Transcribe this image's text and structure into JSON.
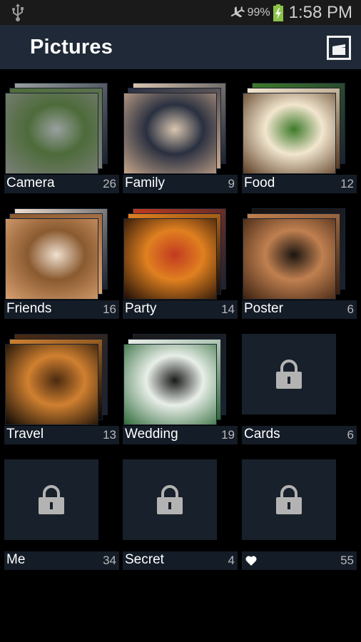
{
  "status_bar": {
    "left_icons": [
      "usb-icon"
    ],
    "right_icons": [
      "airplane-mode-icon",
      "battery-charging-icon"
    ],
    "battery_percent": "99%",
    "time": "1:58 PM",
    "battery_color": "#8bc34a"
  },
  "app_bar": {
    "title": "Pictures",
    "action_icon": "slideshow-icon",
    "background": "#1f2937"
  },
  "albums": [
    {
      "name": "Camera",
      "count": "26",
      "locked": false,
      "thumb": "gray cat sleeping",
      "colors": [
        "#7a7f78",
        "#4d6b3a",
        "#9aa0a0"
      ]
    },
    {
      "name": "Family",
      "count": "9",
      "locked": false,
      "thumb": "woman kissing baby in striped hat",
      "colors": [
        "#c7a68a",
        "#2a3040",
        "#d9c6b0"
      ]
    },
    {
      "name": "Food",
      "count": "12",
      "locked": false,
      "thumb": "plate with green beans and bread",
      "colors": [
        "#5a3c22",
        "#f2e6cf",
        "#3e7a2a"
      ]
    },
    {
      "name": "Friends",
      "count": "16",
      "locked": false,
      "thumb": "two smiling girls with sunglasses",
      "colors": [
        "#d9a070",
        "#8a5a30",
        "#f0e0d0"
      ]
    },
    {
      "name": "Party",
      "count": "14",
      "locked": false,
      "thumb": "birthday candles on cake",
      "colors": [
        "#1a0c06",
        "#e08020",
        "#c23a20"
      ]
    },
    {
      "name": "Poster",
      "count": "6",
      "locked": false,
      "thumb": "Titanic movie poster",
      "colors": [
        "#3a2010",
        "#c08050",
        "#1a1410"
      ]
    },
    {
      "name": "Travel",
      "count": "13",
      "locked": false,
      "thumb": "illuminated square at night",
      "colors": [
        "#0a0604",
        "#d08030",
        "#4a2a10"
      ]
    },
    {
      "name": "Wedding",
      "count": "19",
      "locked": false,
      "thumb": "wedding couple kissing",
      "colors": [
        "#2f6a3a",
        "#e8eee8",
        "#1a1a1a"
      ]
    },
    {
      "name": "Cards",
      "count": "6",
      "locked": true
    },
    {
      "name": "Me",
      "count": "34",
      "locked": true
    },
    {
      "name": "Secret",
      "count": "4",
      "locked": true
    },
    {
      "name": "",
      "count": "55",
      "locked": true,
      "label_icon": "heart-icon"
    }
  ]
}
